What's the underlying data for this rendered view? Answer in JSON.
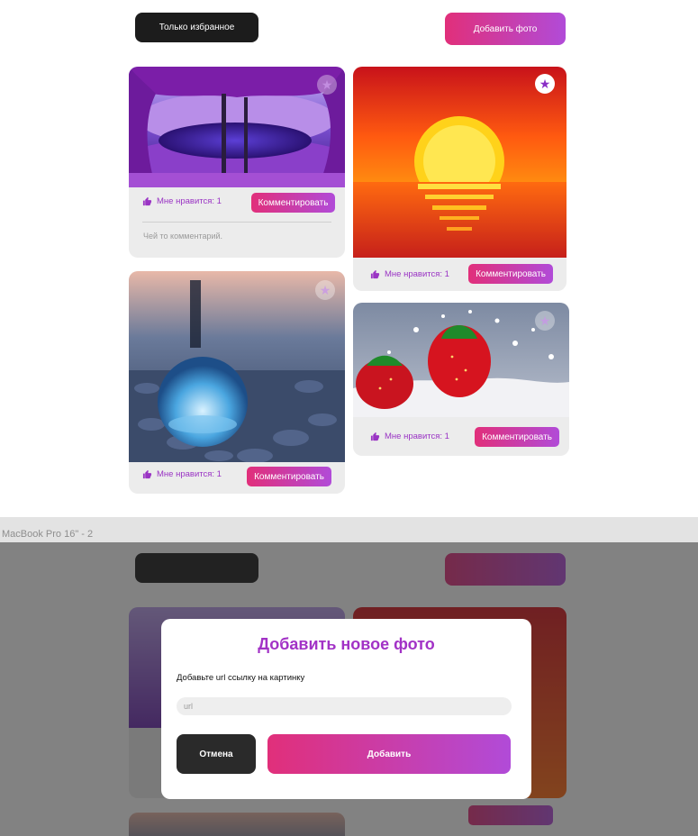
{
  "header": {
    "favorites_label": "Только избранное",
    "add_photo_label": "Добавить фото"
  },
  "cards": [
    {
      "alt": "purple lake",
      "like_label": "Мне нравится: 1",
      "comment_button": "Комментировать",
      "favorite": false,
      "comment": "Чей то комментарий."
    },
    {
      "alt": "sunset over sea",
      "like_label": "Мне нравится: 1",
      "comment_button": "Комментировать",
      "favorite": true
    },
    {
      "alt": "crystal ball on pebbles",
      "like_label": "Мне нравится: 1",
      "comment_button": "Комментировать",
      "favorite": false
    },
    {
      "alt": "strawberries in milk",
      "like_label": "Мне нравится: 1",
      "comment_button": "Комментировать",
      "favorite": false
    }
  ],
  "frame_label": "MacBook Pro 16\" - 2",
  "modal": {
    "title": "Добавить новое фото",
    "input_label": "Добавьте url ссылку на картинку",
    "input_placeholder": "url",
    "cancel_label": "Отмена",
    "submit_label": "Добавить"
  },
  "colors": {
    "accent_purple": "#a232c6",
    "gradient_start": "#e12f7a",
    "gradient_end": "#b14bd8",
    "dark_button": "#1c1c1c"
  },
  "icons": {
    "like": "thumbs-up-icon",
    "favorite": "star-icon"
  }
}
